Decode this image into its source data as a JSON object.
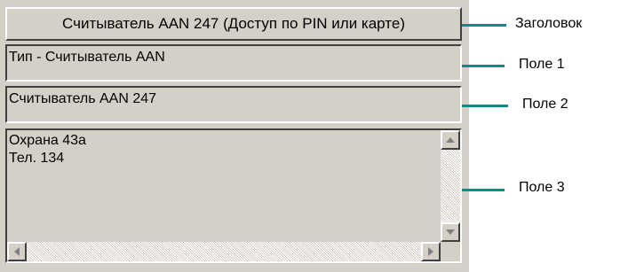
{
  "window": {
    "header": "Считыватель AAN 247 (Доступ по PIN или карте)",
    "field1": "Тип - Считыватель AAN",
    "field2": "Считыватель AAN 247",
    "memo_lines": [
      "Охрана 43а",
      "Тел. 134"
    ]
  },
  "callouts": {
    "header_label": "Заголовок",
    "field1_label": "Поле 1",
    "field2_label": "Поле 2",
    "field3_label": "Поле 3"
  },
  "colors": {
    "panel": "#d4d0c8",
    "callout_line": "#0f8c86"
  }
}
